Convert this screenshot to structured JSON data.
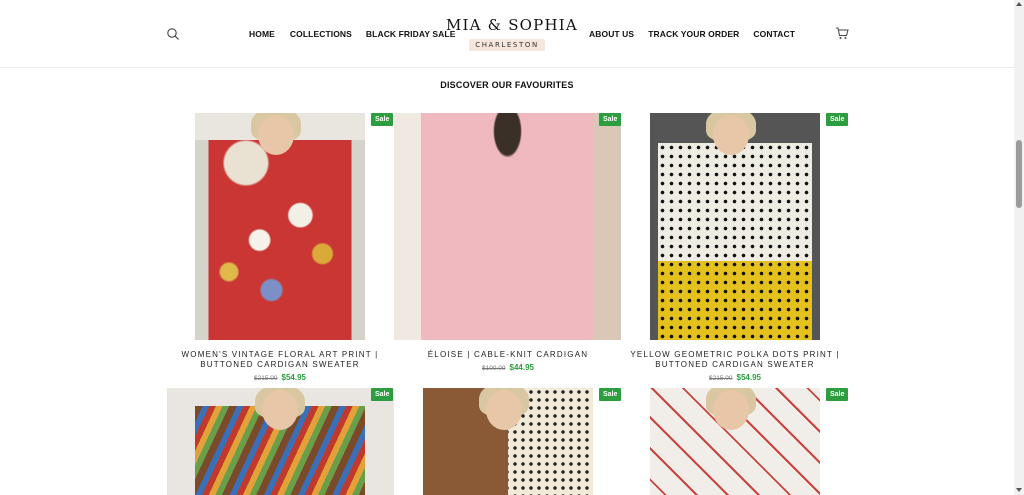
{
  "header": {
    "nav_left": [
      "HOME",
      "COLLECTIONS",
      "BLACK FRIDAY SALE"
    ],
    "nav_right": [
      "ABOUT US",
      "TRACK YOUR ORDER",
      "CONTACT"
    ],
    "logo_main": "MIA & SOPHIA",
    "logo_sub": "CHARLESTON",
    "icons": {
      "search": "search-icon",
      "cart": "cart-icon"
    }
  },
  "section": {
    "title": "DISCOVER OUR FAVOURITES"
  },
  "sale_badge": "Sale",
  "colors": {
    "sale_green": "#2c9e3f",
    "price_green": "#2c9e3f"
  },
  "products": [
    {
      "title": "WOMEN'S VINTAGE FLORAL ART PRINT | BUTTONED CARDIGAN SWEATER",
      "old_price": "$215.00",
      "new_price": "$54.95"
    },
    {
      "title": "ÉLOISE | CABLE-KNIT CARDIGAN",
      "old_price": "$100.00",
      "new_price": "$44.95"
    },
    {
      "title": "YELLOW GEOMETRIC POLKA DOTS PRINT | BUTTONED CARDIGAN SWEATER",
      "old_price": "$215.00",
      "new_price": "$54.95"
    },
    {
      "title": "",
      "old_price": "",
      "new_price": ""
    },
    {
      "title": "",
      "old_price": "",
      "new_price": ""
    },
    {
      "title": "",
      "old_price": "",
      "new_price": ""
    }
  ]
}
